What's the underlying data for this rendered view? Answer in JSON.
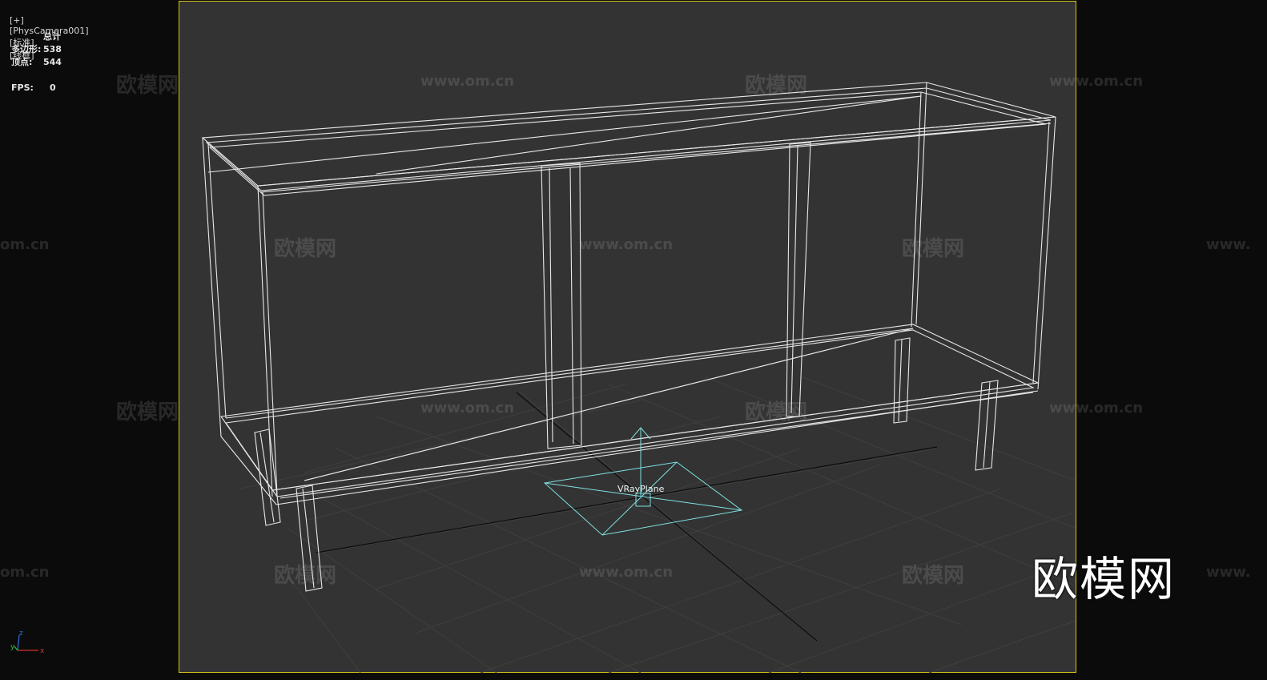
{
  "viewport": {
    "label_parts": [
      "[+]",
      "[PhysCamera001]",
      "[标准]",
      "[线框]"
    ],
    "active_border_color": "#d6c21a",
    "background_color": "#333333"
  },
  "stats": {
    "header": "总计",
    "polygons_label": "多边形:",
    "polygons_value": "538",
    "vertices_label": "顶点:",
    "vertices_value": "544",
    "fps_label": "FPS:",
    "fps_value": "0"
  },
  "scene": {
    "object_label": "VRayPlane",
    "wire_color": "#e8e8e8",
    "helper_color": "#7fe0e0"
  },
  "watermark": {
    "cn": "欧模网",
    "url": "www.om.cn",
    "url_left_cut": "om.cn",
    "url_right_cut": "www.",
    "logo": "欧模网"
  },
  "axis_tripod": {
    "x": "x",
    "y": "y",
    "z": "z"
  }
}
